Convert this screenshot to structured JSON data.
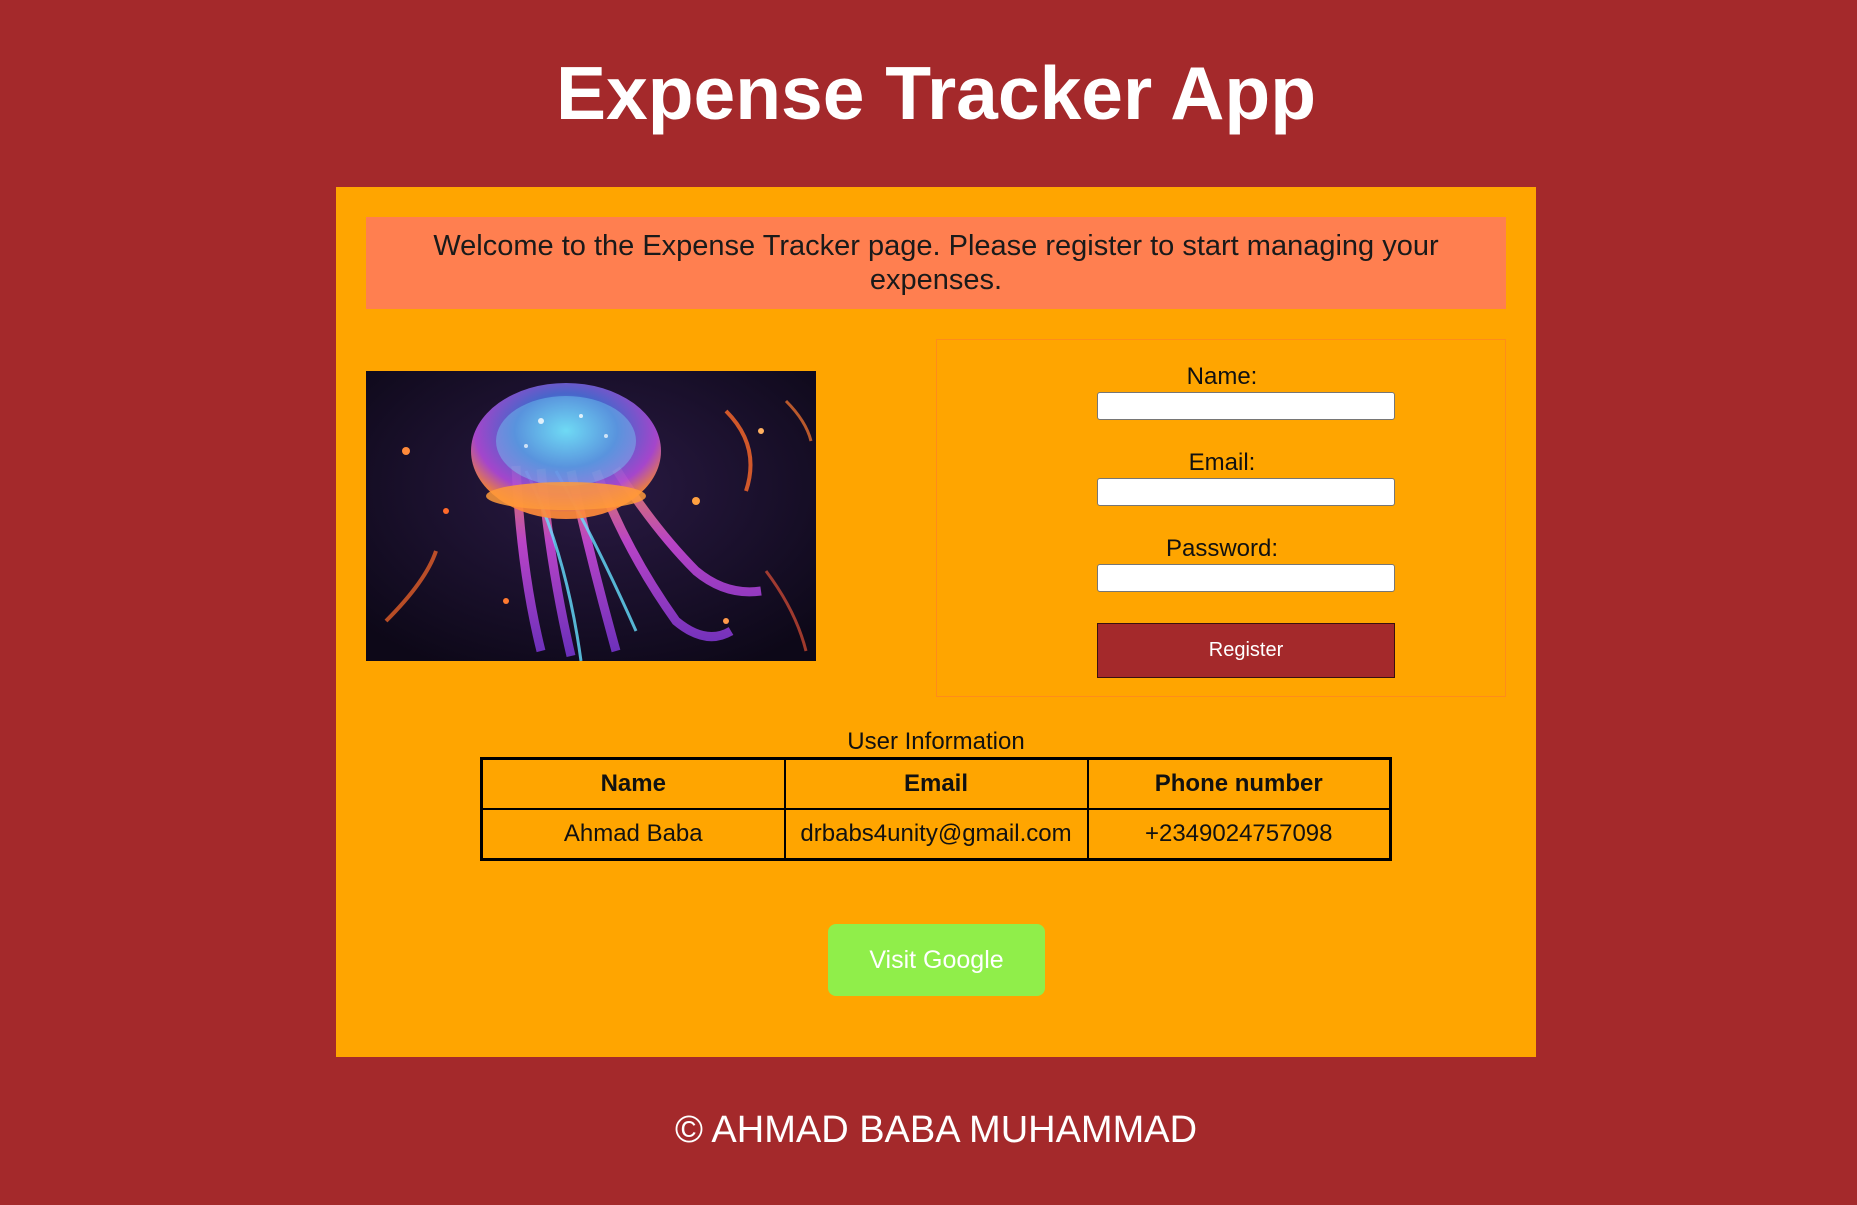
{
  "page": {
    "title": "Expense Tracker App",
    "background_color": "#a4292b"
  },
  "main": {
    "card_color": "#ffa500",
    "welcome_text": "Welcome to the Expense Tracker page. Please register to start managing your expenses.",
    "welcome_color": "#ff7f50",
    "image": {
      "subject": "glowing jellyfish illustration",
      "icon": "jellyfish-image"
    },
    "form": {
      "name_label": "Name:",
      "name_value": "",
      "email_label": "Email:",
      "email_value": "",
      "password_label": "Password:",
      "password_value": "",
      "register_label": "Register",
      "register_color": "#a4292b"
    },
    "table": {
      "caption": "User Information",
      "headers": [
        "Name",
        "Email",
        "Phone number"
      ],
      "rows": [
        [
          "Ahmad Baba",
          "drbabs4unity@gmail.com",
          "+2349024757098"
        ]
      ]
    },
    "visit_button": {
      "label": "Visit Google",
      "color": "#90ee4a"
    }
  },
  "footer": {
    "text": "© AHMAD BABA MUHAMMAD"
  }
}
